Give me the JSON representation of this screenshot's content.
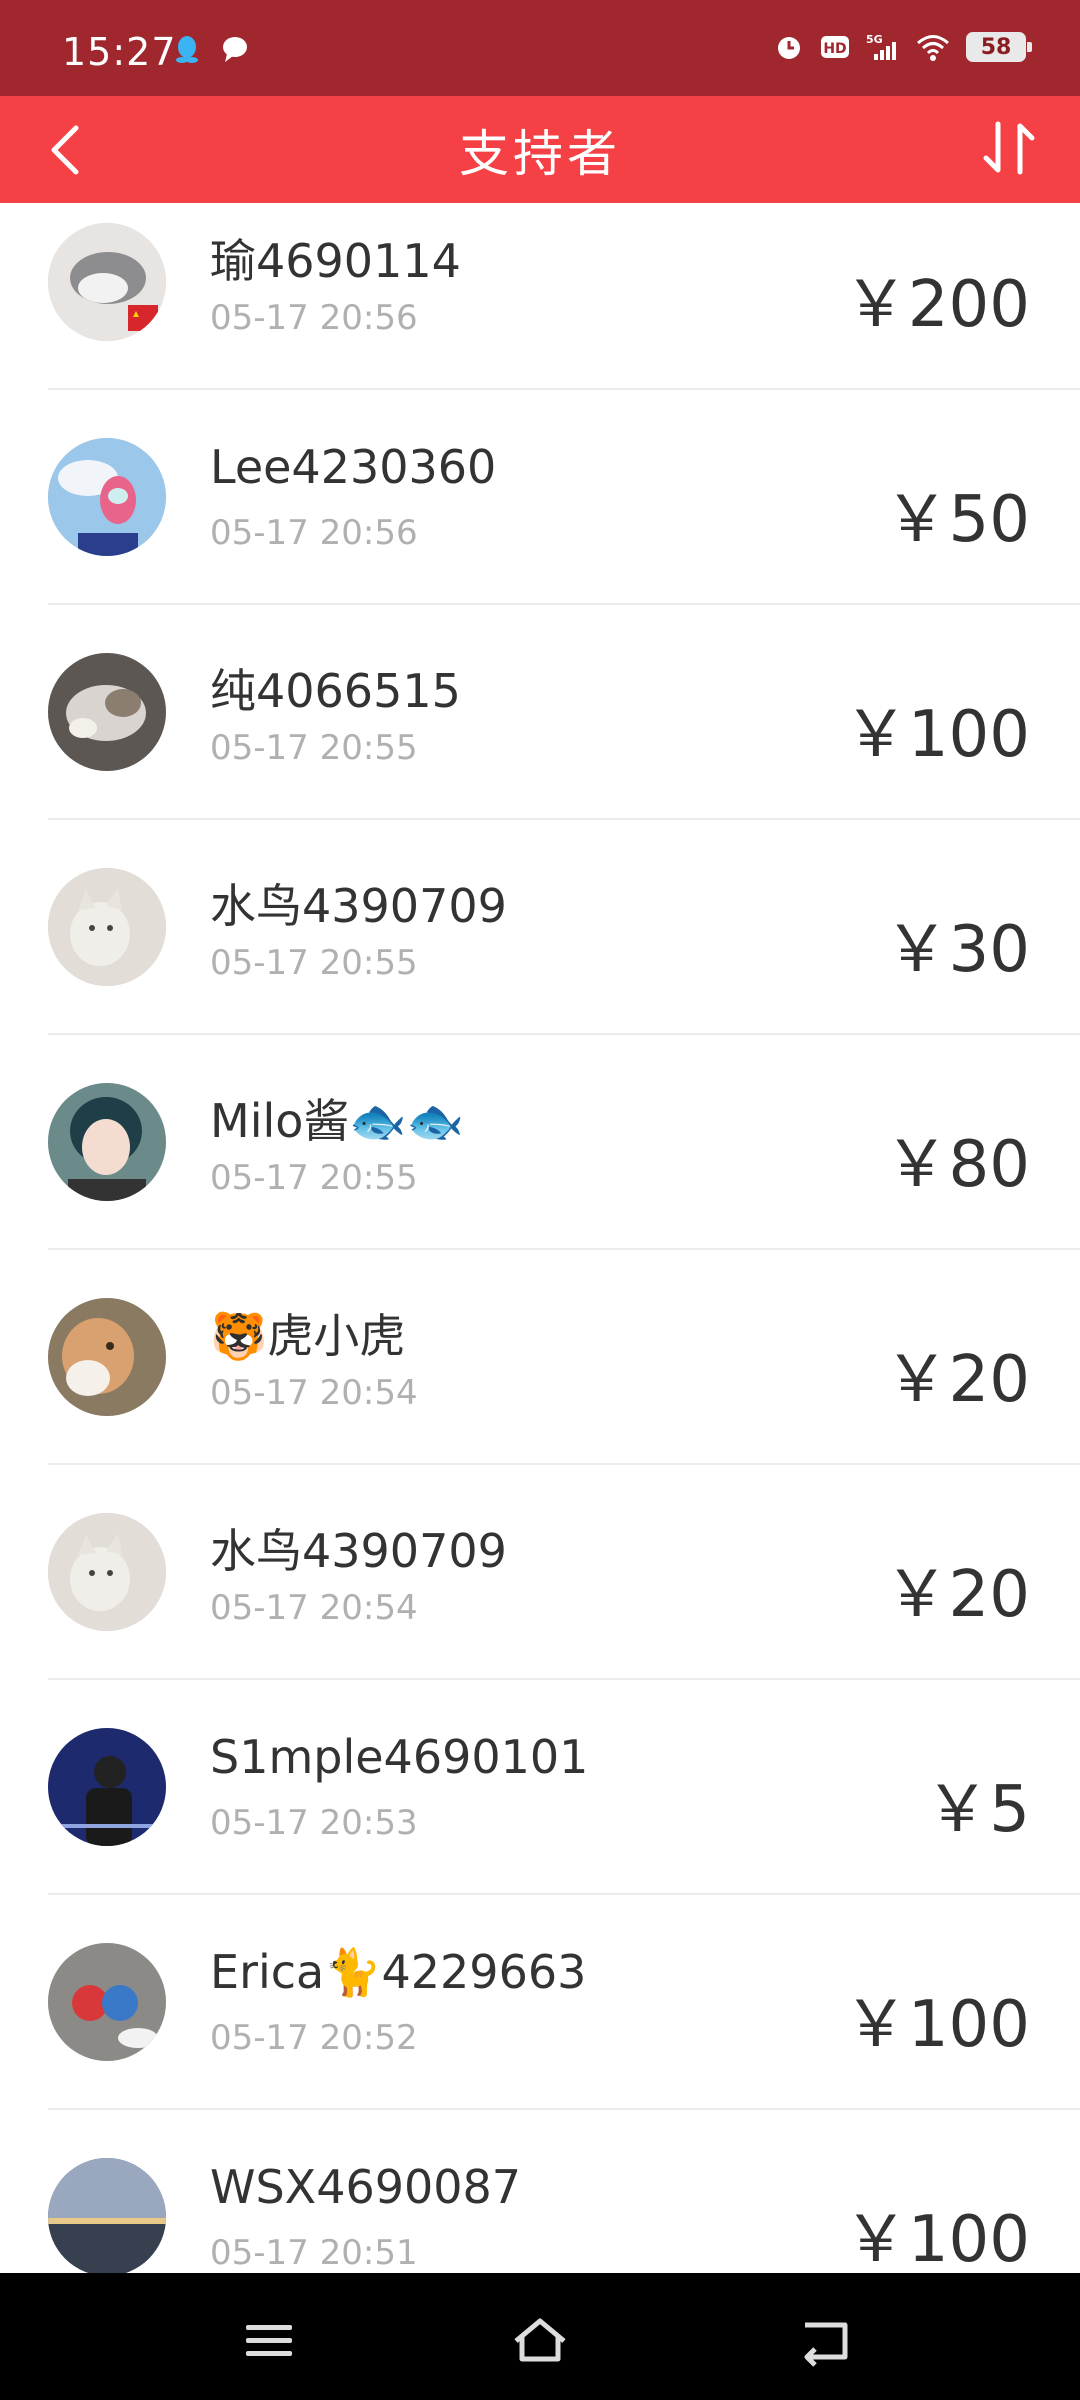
{
  "status_bar": {
    "time": "15:27",
    "battery": "58",
    "icons": [
      "qq-icon",
      "chat-bubble-icon",
      "alarm-icon",
      "hd-icon",
      "signal-5g-icon",
      "wifi-icon",
      "battery-icon"
    ]
  },
  "header": {
    "title": "支持者",
    "back_icon": "chevron-left-icon",
    "sort_icon": "sort-arrows-icon",
    "color": "#f54145"
  },
  "supporters": [
    {
      "name": "瑜4690114",
      "time": "05-17 20:56",
      "amount": "￥200"
    },
    {
      "name": "Lee4230360",
      "time": "05-17 20:56",
      "amount": "￥50"
    },
    {
      "name": "纯4066515",
      "time": "05-17 20:55",
      "amount": "￥100"
    },
    {
      "name": "水鸟4390709",
      "time": "05-17 20:55",
      "amount": "￥30"
    },
    {
      "name": "Milo酱🐟🐟",
      "time": "05-17 20:55",
      "amount": "￥80"
    },
    {
      "name": "🐯虎小虎",
      "time": "05-17 20:54",
      "amount": "￥20"
    },
    {
      "name": "水鸟4390709",
      "time": "05-17 20:54",
      "amount": "￥20"
    },
    {
      "name": "S1mple4690101",
      "time": "05-17 20:53",
      "amount": "￥5"
    },
    {
      "name": "Erica🐈4229663",
      "time": "05-17 20:52",
      "amount": "￥100"
    },
    {
      "name": "WSX4690087",
      "time": "05-17 20:51",
      "amount": "￥100"
    }
  ],
  "nav_bar": {
    "icons": [
      "menu-icon",
      "home-icon",
      "back-icon"
    ]
  }
}
